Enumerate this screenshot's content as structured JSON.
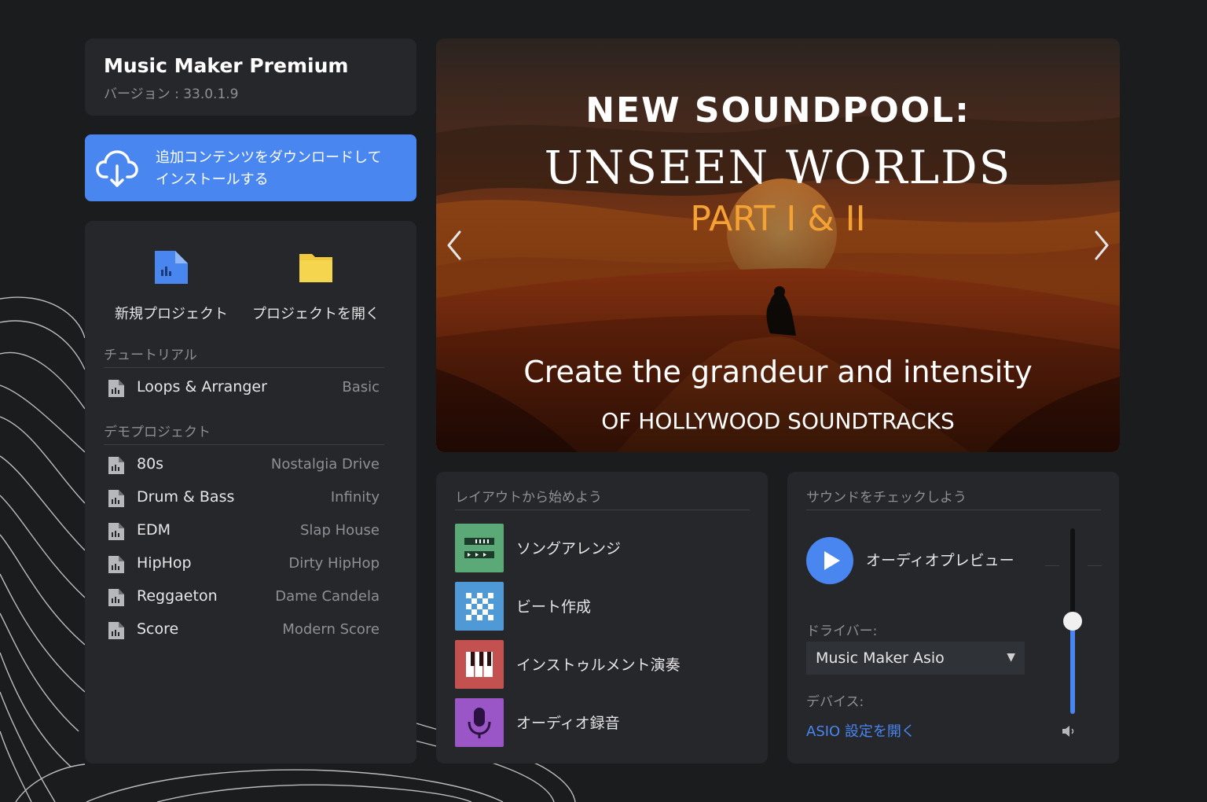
{
  "app": {
    "title": "Music Maker Premium",
    "version": "バージョン : 33.0.1.9"
  },
  "download": {
    "line1": "追加コンテンツをダウンロードして",
    "line2": "インストールする",
    "icon": "cloud-download-icon"
  },
  "quick_actions": {
    "new_project": "新規プロジェクト",
    "open_project": "プロジェクトを開く"
  },
  "tutorial": {
    "heading": "チュートリアル",
    "items": [
      {
        "name": "Loops & Arranger",
        "meta": "Basic"
      }
    ]
  },
  "demo": {
    "heading": "デモプロジェクト",
    "items": [
      {
        "name": "80s",
        "meta": "Nostalgia Drive"
      },
      {
        "name": "Drum & Bass",
        "meta": "Infinity"
      },
      {
        "name": "EDM",
        "meta": "Slap House"
      },
      {
        "name": "HipHop",
        "meta": "Dirty HipHop"
      },
      {
        "name": "Reggaeton",
        "meta": "Dame Candela"
      },
      {
        "name": "Score",
        "meta": "Modern Score"
      }
    ]
  },
  "banner": {
    "line1": "NEW SOUNDPOOL:",
    "line2": "UNSEEN WORLDS",
    "line3": "PART I & II",
    "line4": "Create the grandeur and intensity",
    "line5": "OF HOLLYWOOD SOUNDTRACKS"
  },
  "layout": {
    "heading": "レイアウトから始めよう",
    "items": [
      {
        "label": "ソングアレンジ",
        "color": "#5aa977",
        "icon": "song-arrange-icon"
      },
      {
        "label": "ビート作成",
        "color": "#4f9ad6",
        "icon": "beat-grid-icon"
      },
      {
        "label": "インストゥルメント演奏",
        "color": "#c2514f",
        "icon": "piano-icon"
      },
      {
        "label": "オーディオ録音",
        "color": "#9a56c7",
        "icon": "microphone-icon"
      }
    ]
  },
  "sound": {
    "heading": "サウンドをチェックしよう",
    "preview_label": "オーディオプレビュー",
    "driver_label": "ドライバー:",
    "driver_value": "Music Maker Asio",
    "device_label": "デバイス:",
    "asio_link": "ASIO 設定を開く",
    "volume_fraction": 0.5
  },
  "colors": {
    "accent": "#4a86f0",
    "panel": "#25272b",
    "background": "#1b1c1e"
  }
}
